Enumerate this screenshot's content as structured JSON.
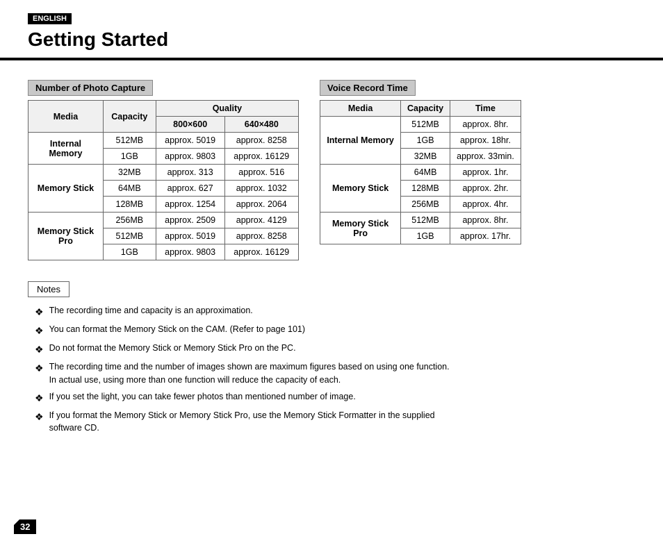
{
  "header": {
    "badge": "ENGLISH",
    "title": "Getting Started"
  },
  "photo_section": {
    "header": "Number of Photo Capture",
    "columns": {
      "media": "Media",
      "capacity": "Capacity",
      "quality": "Quality",
      "res1": "800×600",
      "res2": "640×480"
    },
    "rows": [
      {
        "media": "Internal Memory",
        "capacity": "512MB",
        "val1": "approx. 5019",
        "val2": "approx. 8258",
        "rowspan": 2
      },
      {
        "media": "",
        "capacity": "1GB",
        "val1": "approx. 9803",
        "val2": "approx. 16129"
      },
      {
        "media": "Memory Stick",
        "capacity": "32MB",
        "val1": "approx. 313",
        "val2": "approx. 516",
        "rowspan": 3
      },
      {
        "media": "",
        "capacity": "64MB",
        "val1": "approx. 627",
        "val2": "approx. 1032"
      },
      {
        "media": "",
        "capacity": "128MB",
        "val1": "approx. 1254",
        "val2": "approx. 2064"
      },
      {
        "media": "Memory Stick Pro",
        "capacity": "256MB",
        "val1": "approx. 2509",
        "val2": "approx. 4129",
        "rowspan": 3
      },
      {
        "media": "",
        "capacity": "512MB",
        "val1": "approx. 5019",
        "val2": "approx. 8258"
      },
      {
        "media": "",
        "capacity": "1GB",
        "val1": "approx. 9803",
        "val2": "approx. 16129"
      }
    ]
  },
  "voice_section": {
    "header": "Voice Record Time",
    "columns": {
      "media": "Media",
      "capacity": "Capacity",
      "time": "Time"
    },
    "rows": [
      {
        "media": "Internal Memory",
        "capacity": "512MB",
        "time": "approx. 8hr.",
        "rowspan": 3
      },
      {
        "media": "",
        "capacity": "1GB",
        "time": "approx. 18hr."
      },
      {
        "media": "",
        "capacity": "32MB",
        "time": "approx. 33min."
      },
      {
        "media": "Memory Stick",
        "capacity": "64MB",
        "time": "approx. 1hr.",
        "rowspan": 3
      },
      {
        "media": "",
        "capacity": "128MB",
        "time": "approx. 2hr."
      },
      {
        "media": "",
        "capacity": "256MB",
        "time": "approx. 4hr."
      },
      {
        "media": "Memory Stick Pro",
        "capacity": "512MB",
        "time": "approx. 8hr.",
        "rowspan": 2
      },
      {
        "media": "",
        "capacity": "1GB",
        "time": "approx. 17hr."
      }
    ]
  },
  "notes": {
    "header": "Notes",
    "items": [
      "The recording time and capacity is an approximation.",
      "You can format the Memory Stick on the CAM. (Refer to page 101)",
      "Do not format the Memory Stick or Memory Stick Pro on the PC.",
      "The recording time and the number of images shown are maximum figures based on using one function.\nIn actual use, using more than one function will reduce the capacity of each.",
      "If you set the light, you can take fewer photos than mentioned number of image.",
      "If you format the Memory Stick or Memory Stick Pro, use the Memory Stick Formatter in the supplied\nsoftware CD."
    ]
  },
  "page_number": "32"
}
